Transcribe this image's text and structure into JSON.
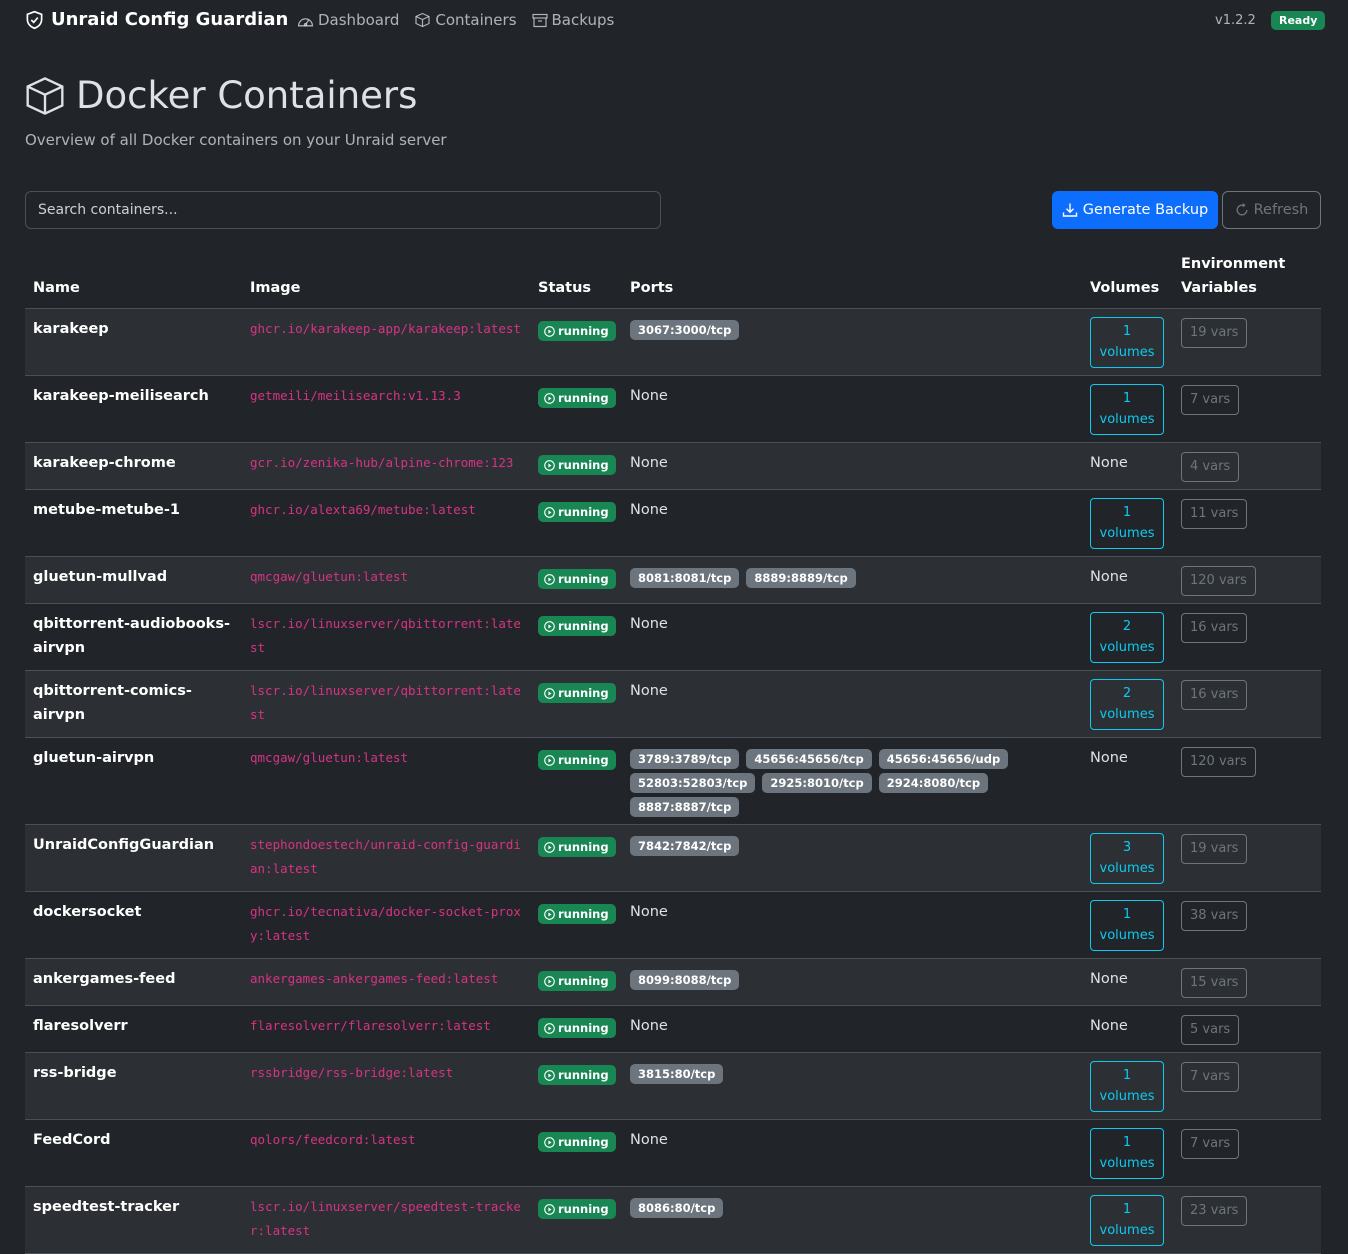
{
  "app": {
    "brand": "Unraid Config Guardian",
    "nav": [
      {
        "label": "Dashboard",
        "icon": "dashboard-icon"
      },
      {
        "label": "Containers",
        "icon": "box-icon"
      },
      {
        "label": "Backups",
        "icon": "archive-icon"
      }
    ],
    "version": "v1.2.2",
    "status_badge": "Ready"
  },
  "page": {
    "title": "Docker Containers",
    "subtitle": "Overview of all Docker containers on your Unraid server"
  },
  "toolbar": {
    "search_placeholder": "Search containers...",
    "generate_label": "Generate Backup",
    "refresh_label": "Refresh"
  },
  "table": {
    "headers": [
      "Name",
      "Image",
      "Status",
      "Ports",
      "Volumes",
      "Environment Variables"
    ],
    "none_label": "None",
    "rows": [
      {
        "name": "karakeep",
        "image": "ghcr.io/karakeep-app/karakeep:latest",
        "status": "running",
        "ports": [
          "3067:3000/tcp"
        ],
        "volumes": {
          "count": "1",
          "label": "volumes"
        },
        "vars": "19 vars"
      },
      {
        "name": "karakeep-meilisearch",
        "image": "getmeili/meilisearch:v1.13.3",
        "status": "running",
        "ports": [],
        "volumes": {
          "count": "1",
          "label": "volumes"
        },
        "vars": "7 vars"
      },
      {
        "name": "karakeep-chrome",
        "image": "gcr.io/zenika-hub/alpine-chrome:123",
        "status": "running",
        "ports": [],
        "volumes": null,
        "vars": "4 vars"
      },
      {
        "name": "metube-metube-1",
        "image": "ghcr.io/alexta69/metube:latest",
        "status": "running",
        "ports": [],
        "volumes": {
          "count": "1",
          "label": "volumes"
        },
        "vars": "11 vars"
      },
      {
        "name": "gluetun-mullvad",
        "image": "qmcgaw/gluetun:latest",
        "status": "running",
        "ports": [
          "8081:8081/tcp",
          "8889:8889/tcp"
        ],
        "volumes": null,
        "vars": "120 vars"
      },
      {
        "name": "qbittorrent-audiobooks-airvpn",
        "image": "lscr.io/linuxserver/qbittorrent:latest",
        "status": "running",
        "ports": [],
        "volumes": {
          "count": "2",
          "label": "volumes"
        },
        "vars": "16 vars"
      },
      {
        "name": "qbittorrent-comics-airvpn",
        "image": "lscr.io/linuxserver/qbittorrent:latest",
        "status": "running",
        "ports": [],
        "volumes": {
          "count": "2",
          "label": "volumes"
        },
        "vars": "16 vars"
      },
      {
        "name": "gluetun-airvpn",
        "image": "qmcgaw/gluetun:latest",
        "status": "running",
        "ports": [
          "3789:3789/tcp",
          "45656:45656/tcp",
          "45656:45656/udp",
          "52803:52803/tcp",
          "2925:8010/tcp",
          "2924:8080/tcp",
          "8887:8887/tcp"
        ],
        "volumes": null,
        "vars": "120 vars"
      },
      {
        "name": "UnraidConfigGuardian",
        "image": "stephondoestech/unraid-config-guardian:latest",
        "status": "running",
        "ports": [
          "7842:7842/tcp"
        ],
        "volumes": {
          "count": "3",
          "label": "volumes"
        },
        "vars": "19 vars"
      },
      {
        "name": "dockersocket",
        "image": "ghcr.io/tecnativa/docker-socket-proxy:latest",
        "status": "running",
        "ports": [],
        "volumes": {
          "count": "1",
          "label": "volumes"
        },
        "vars": "38 vars"
      },
      {
        "name": "ankergames-feed",
        "image": "ankergames-ankergames-feed:latest",
        "status": "running",
        "ports": [
          "8099:8088/tcp"
        ],
        "volumes": null,
        "vars": "15 vars"
      },
      {
        "name": "flaresolverr",
        "image": "flaresolverr/flaresolverr:latest",
        "status": "running",
        "ports": [],
        "volumes": null,
        "vars": "5 vars"
      },
      {
        "name": "rss-bridge",
        "image": "rssbridge/rss-bridge:latest",
        "status": "running",
        "ports": [
          "3815:80/tcp"
        ],
        "volumes": {
          "count": "1",
          "label": "volumes"
        },
        "vars": "7 vars"
      },
      {
        "name": "FeedCord",
        "image": "qolors/feedcord:latest",
        "status": "running",
        "ports": [],
        "volumes": {
          "count": "1",
          "label": "volumes"
        },
        "vars": "7 vars"
      },
      {
        "name": "speedtest-tracker",
        "image": "lscr.io/linuxserver/speedtest-tracker:latest",
        "status": "running",
        "ports": [
          "8086:80/tcp"
        ],
        "volumes": {
          "count": "1",
          "label": "volumes"
        },
        "vars": "23 vars"
      }
    ]
  },
  "colors": {
    "background": "#212529",
    "accent": "#0d6efd",
    "success": "#198754",
    "image_text": "#d63384",
    "volumes_outline": "#0dcaf0"
  }
}
